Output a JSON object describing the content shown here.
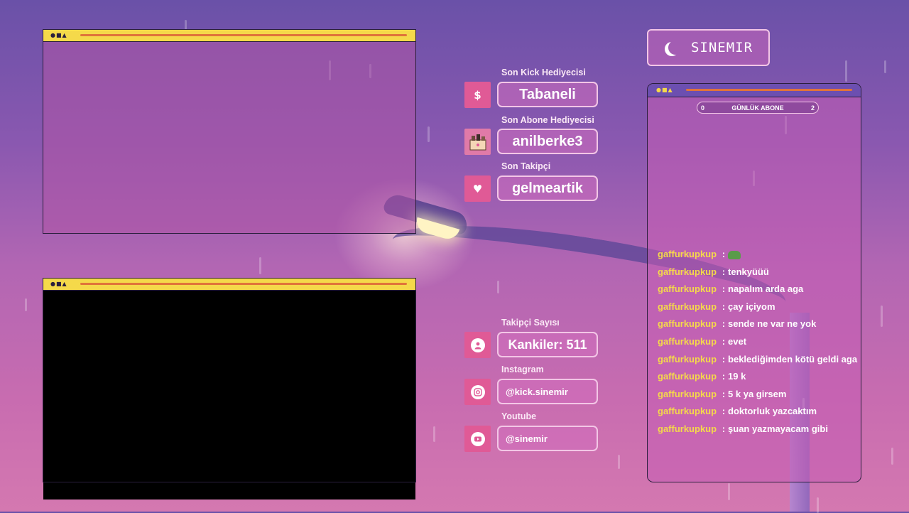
{
  "overlay": {
    "stats": {
      "last_kick_gifter": {
        "label": "Son Kick Hediyecisi",
        "value": "Tabaneli",
        "icon": "dollar-icon"
      },
      "last_sub_gifter": {
        "label": "Son Abone Hediyecisi",
        "value": "anilberke3",
        "icon": "gift-icon"
      },
      "last_follower": {
        "label": "Son Takipçi",
        "value": "gelmeartik",
        "icon": "heart-icon"
      },
      "follower_count": {
        "label": "Takipçi Sayısı",
        "value": "Kankiler: 511",
        "icon": "user-icon"
      },
      "instagram": {
        "label": "Instagram",
        "value": "@kick.sinemir",
        "icon": "instagram-icon"
      },
      "youtube": {
        "label": "Youtube",
        "value": "@sinemir",
        "icon": "youtube-icon"
      }
    },
    "streamer": {
      "name": "SINEMIR",
      "icon": "moon-icon"
    },
    "sub_goal": {
      "label": "GÜNLÜK ABONE",
      "min": "0",
      "max": "2",
      "progress": 0
    },
    "chat": [
      {
        "user": "gaffurkupkup",
        "sep": ":",
        "text": "",
        "emote": "frog-emote"
      },
      {
        "user": "gaffurkupkup",
        "sep": ":",
        "text": "tenkyüüü"
      },
      {
        "user": "gaffurkupkup",
        "sep": ":",
        "text": "napalım arda aga"
      },
      {
        "user": "gaffurkupkup",
        "sep": ":",
        "text": "çay içiyom"
      },
      {
        "user": "gaffurkupkup",
        "sep": ":",
        "text": "sende ne var ne yok"
      },
      {
        "user": "gaffurkupkup",
        "sep": ":",
        "text": "evet"
      },
      {
        "user": "gaffurkupkup",
        "sep": ":",
        "text": "beklediğimden kötü geldi aga"
      },
      {
        "user": "gaffurkupkup",
        "sep": ":",
        "text": "19 k"
      },
      {
        "user": "gaffurkupkup",
        "sep": ":",
        "text": "5 k ya girsem"
      },
      {
        "user": "gaffurkupkup",
        "sep": ":",
        "text": "doktorluk yazcaktım"
      },
      {
        "user": "gaffurkupkup",
        "sep": ":",
        "text": "şuan yazmayacam gibi"
      }
    ],
    "window_controls": "●■▲",
    "colors": {
      "accent_yellow": "#f5d94a",
      "accent_pink": "#e05a96",
      "frame_dark": "#2a1f3d"
    }
  }
}
